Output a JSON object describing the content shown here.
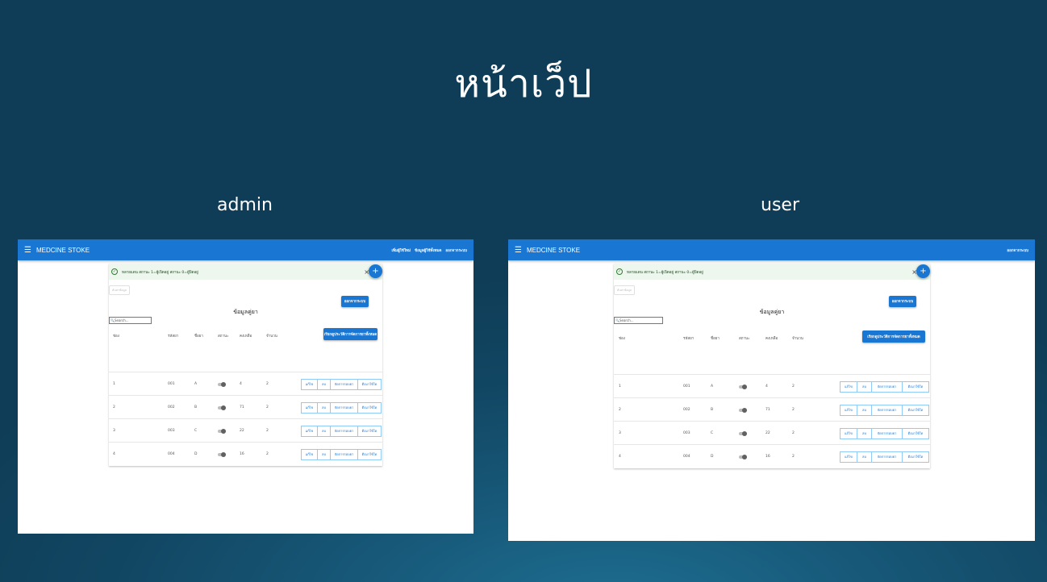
{
  "slide": {
    "title": "หน้าเว็ป",
    "captions": [
      "admin",
      "user"
    ]
  },
  "screens": [
    {
      "app_title": "MEDCINE STOKE",
      "nav": [
        "เพิ่มผู้ใช้ใหม่",
        "ข้อมูลผู้ใช้ทั้งหมด",
        "ออกจากระบบ"
      ],
      "alert": "หลายแดน สถานะ 1=ผู้เปิดอยู่ สถานะ 0=ผู้ปิดอยู่",
      "close": "×",
      "fab": "+",
      "ghost_button": "ค้นหาข้อมูล",
      "logout_button": "ออกจากระบบ",
      "table_title": "ข้อมูลคู่ยา",
      "search_placeholder": "Search...",
      "bulk_button": "เรียกดูประวัติการจัดการยาทั้งหมด",
      "columns": [
        "ช่อง",
        "รหัสยา",
        "ชื่อยา",
        "สถานะ",
        "คงเหลือ",
        "จำนวน"
      ],
      "rows": [
        {
          "slot": "1",
          "code": "001",
          "name": "A",
          "remaining": "4",
          "qty": "2"
        },
        {
          "slot": "2",
          "code": "002",
          "name": "B",
          "remaining": "71",
          "qty": "2"
        },
        {
          "slot": "3",
          "code": "003",
          "name": "C",
          "remaining": "22",
          "qty": "2"
        },
        {
          "slot": "4",
          "code": "004",
          "name": "D",
          "remaining": "16",
          "qty": "2"
        }
      ],
      "row_actions": [
        "แก้ไข",
        "ลบ",
        "จัดการรอบยา",
        "ดึงมาใช้ใด"
      ]
    },
    {
      "app_title": "MEDCINE STOKE",
      "nav": [
        "ออกจากระบบ"
      ],
      "alert": "หลายแดน สถานะ 1=ผู้เปิดอยู่ สถานะ 0=ผู้ปิดอยู่",
      "close": "×",
      "fab": "+",
      "ghost_button": "ค้นหาข้อมูล",
      "logout_button": "ออกจากระบบ",
      "table_title": "ข้อมูลคู่ยา",
      "search_placeholder": "Search...",
      "bulk_button": "เรียกดูประวัติการจัดการยาทั้งหมด",
      "columns": [
        "ช่อง",
        "รหัสยา",
        "ชื่อยา",
        "สถานะ",
        "คงเหลือ",
        "จำนวน"
      ],
      "rows": [
        {
          "slot": "1",
          "code": "001",
          "name": "A",
          "remaining": "4",
          "qty": "2"
        },
        {
          "slot": "2",
          "code": "002",
          "name": "B",
          "remaining": "71",
          "qty": "2"
        },
        {
          "slot": "3",
          "code": "003",
          "name": "C",
          "remaining": "22",
          "qty": "2"
        },
        {
          "slot": "4",
          "code": "004",
          "name": "D",
          "remaining": "16",
          "qty": "2"
        }
      ],
      "row_actions": [
        "แก้ไข",
        "ลบ",
        "จัดการรอบยา",
        "ดึงมาใช้ใด"
      ]
    }
  ]
}
